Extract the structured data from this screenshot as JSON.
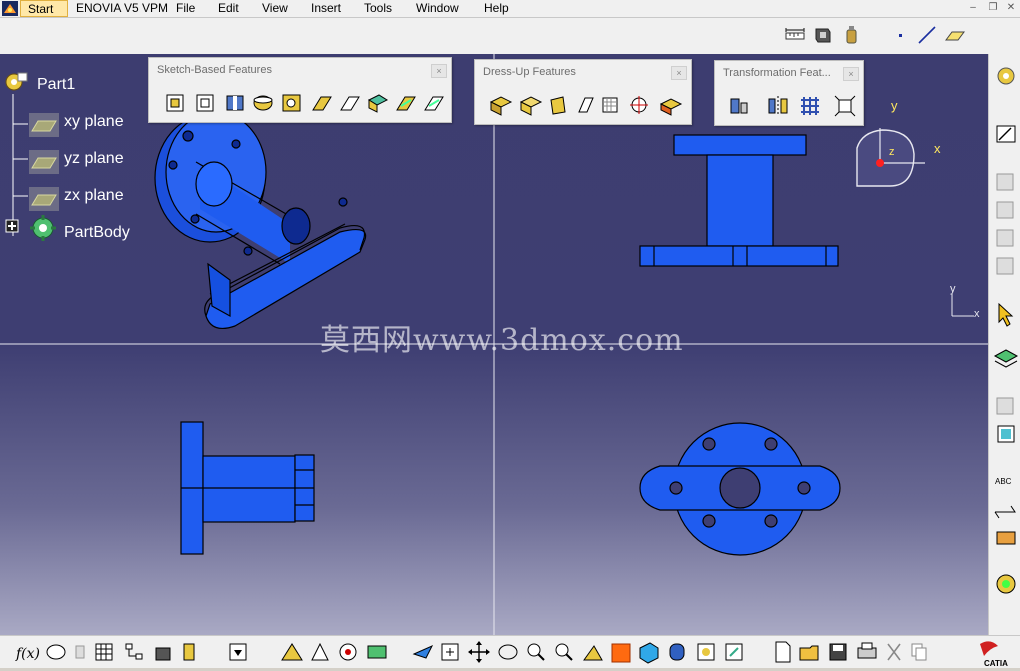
{
  "menubar": {
    "start": "Start",
    "enovia": "ENOVIA V5 VPM",
    "file": "File",
    "edit": "Edit",
    "view": "View",
    "insert": "Insert",
    "tools": "Tools",
    "window": "Window",
    "help": "Help"
  },
  "tree": {
    "root": "Part1",
    "items": [
      "xy plane",
      "yz plane",
      "zx plane"
    ],
    "body": "PartBody"
  },
  "toolbars": {
    "sketch_based": "Sketch-Based Features",
    "dress_up": "Dress-Up Features",
    "transformation": "Transformation Feat..."
  },
  "compass": {
    "x": "x",
    "y": "y",
    "z": "z"
  },
  "axis_small": {
    "x": "x",
    "y": "y"
  },
  "watermark": "莫西网www.3dmox.com",
  "colors": {
    "part_blue": "#1f5cf0",
    "viewport_top": "#3d3d70",
    "viewport_bottom": "#a9a9c4"
  }
}
